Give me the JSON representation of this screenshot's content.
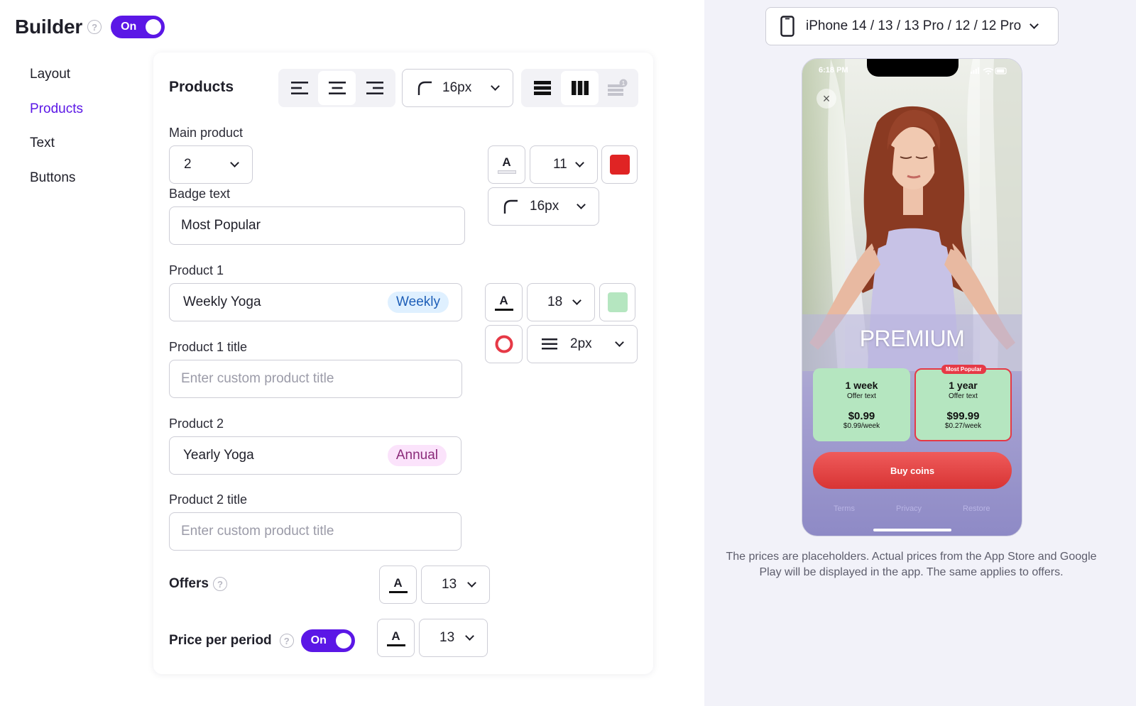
{
  "header": {
    "title": "Builder",
    "toggle_label": "On"
  },
  "nav": [
    {
      "label": "Layout",
      "active": false
    },
    {
      "label": "Products",
      "active": true
    },
    {
      "label": "Text",
      "active": false
    },
    {
      "label": "Buttons",
      "active": false
    }
  ],
  "products": {
    "section_title": "Products",
    "alignment_selected": "center",
    "corner_radius": "16px",
    "layout_selected": "columns",
    "main_product": {
      "label": "Main product",
      "value": "2"
    },
    "badge": {
      "label": "Badge text",
      "value": "Most Popular",
      "font_size": "11",
      "color": "#e02424",
      "radius": "16px"
    },
    "product1": {
      "label": "Product 1",
      "value": "Weekly Yoga",
      "tag": "Weekly",
      "font_size": "18",
      "bg_color": "#b5e6c0",
      "border_width": "2px",
      "title_label": "Product 1 title",
      "title_placeholder": "Enter custom product title"
    },
    "product2": {
      "label": "Product 2",
      "value": "Yearly Yoga",
      "tag": "Annual",
      "title_label": "Product 2 title",
      "title_placeholder": "Enter custom product title"
    },
    "offers": {
      "label": "Offers",
      "font_size": "13"
    },
    "price_per_period": {
      "label": "Price per period",
      "toggle_label": "On",
      "font_size": "13"
    }
  },
  "preview": {
    "device": "iPhone 14 / 13 / 13 Pro / 12 / 12 Pro",
    "time": "6:18 PM",
    "heading": "PREMIUM",
    "cards": [
      {
        "title": "1 week",
        "offer": "Offer text",
        "price": "$0.99",
        "per_period": "$0.99/week"
      },
      {
        "title": "1 year",
        "offer": "Offer text",
        "price": "$99.99",
        "per_period": "$0.27/week"
      }
    ],
    "badge": "Most Popular",
    "buy_label": "Buy coins",
    "links": [
      "Terms",
      "Privacy",
      "Restore"
    ],
    "note": "The prices are placeholders. Actual prices from the App Store and Google Play will be displayed in the app. The same applies to offers."
  }
}
